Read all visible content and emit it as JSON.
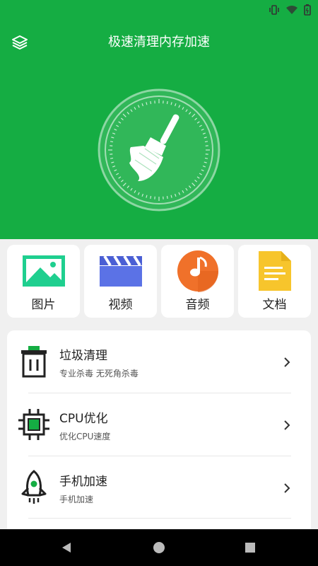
{
  "header": {
    "title": "极速清理内存加速"
  },
  "categories": [
    {
      "label": "图片",
      "icon": "image-icon"
    },
    {
      "label": "视频",
      "icon": "video-clapper-icon"
    },
    {
      "label": "音频",
      "icon": "music-note-icon"
    },
    {
      "label": "文档",
      "icon": "document-icon"
    }
  ],
  "features": [
    {
      "title": "垃圾清理",
      "subtitle": "专业杀毒 无死角杀毒",
      "icon": "trash-bin-icon"
    },
    {
      "title": "CPU优化",
      "subtitle": "优化CPU速度",
      "icon": "cpu-chip-icon"
    },
    {
      "title": "手机加速",
      "subtitle": "手机加速",
      "icon": "rocket-icon"
    }
  ],
  "colors": {
    "brand": "#15ad43",
    "image_green": "#1fcf8f",
    "video_blue": "#5b72e6",
    "audio_orange": "#f0712a",
    "doc_yellow": "#f7c52c"
  }
}
